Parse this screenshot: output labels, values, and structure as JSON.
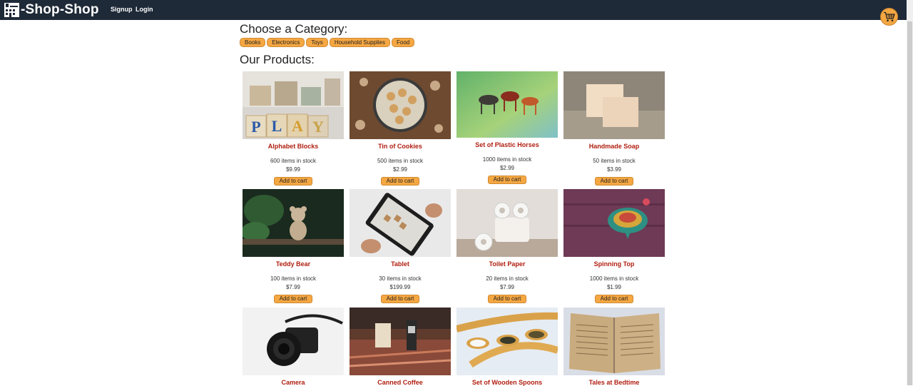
{
  "nav": {
    "brand": "-Shop-Shop",
    "links": [
      "Signup",
      "Login"
    ]
  },
  "categories": {
    "heading": "Choose a Category:",
    "items": [
      "Books",
      "Electronics",
      "Toys",
      "Household Supplies",
      "Food"
    ]
  },
  "products": {
    "heading": "Our Products:",
    "add_label": "Add to cart",
    "items": [
      {
        "name": "Alphabet Blocks",
        "stock": "600 items in stock",
        "price": "$9.99"
      },
      {
        "name": "Tin of Cookies",
        "stock": "500 items in stock",
        "price": "$2.99"
      },
      {
        "name": "Set of Plastic Horses",
        "stock": "1000 items in stock",
        "price": "$2.99"
      },
      {
        "name": "Handmade Soap",
        "stock": "50 items in stock",
        "price": "$3.99"
      },
      {
        "name": "Teddy Bear",
        "stock": "100 items in stock",
        "price": "$7.99"
      },
      {
        "name": "Tablet",
        "stock": "30 items in stock",
        "price": "$199.99"
      },
      {
        "name": "Toilet Paper",
        "stock": "20 items in stock",
        "price": "$7.99"
      },
      {
        "name": "Spinning Top",
        "stock": "1000 items in stock",
        "price": "$1.99"
      },
      {
        "name": "Camera",
        "stock": "",
        "price": ""
      },
      {
        "name": "Canned Coffee",
        "stock": "",
        "price": ""
      },
      {
        "name": "Set of Wooden Spoons",
        "stock": "",
        "price": ""
      },
      {
        "name": "Tales at Bedtime",
        "stock": "",
        "price": ""
      }
    ]
  },
  "colors": {
    "navbar": "#1f2a38",
    "accent": "#f5a742",
    "product_name": "#b01e10"
  },
  "icons": {
    "brand": "shop-building-icon",
    "cart": "shopping-cart-icon"
  }
}
